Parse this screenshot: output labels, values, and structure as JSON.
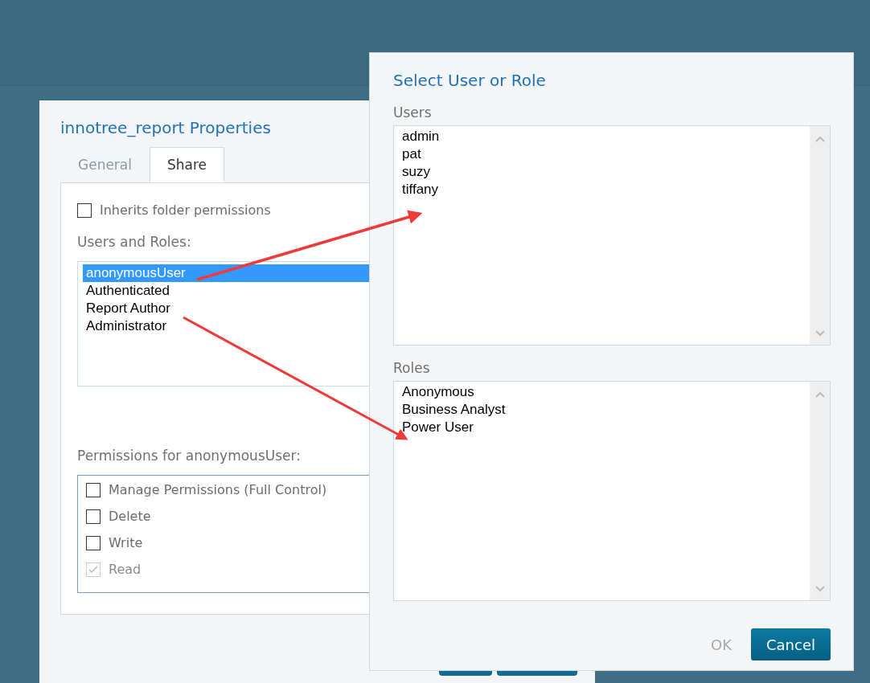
{
  "properties_dialog": {
    "title": "innotree_report Properties",
    "tabs": [
      {
        "label": "General",
        "selected": false
      },
      {
        "label": "Share",
        "selected": true
      }
    ],
    "inherit_checkbox": {
      "label": "Inherits folder permissions",
      "checked": false
    },
    "users_and_roles_label": "Users and Roles:",
    "users_and_roles": [
      {
        "name": "anonymousUser",
        "selected": true
      },
      {
        "name": "Authenticated",
        "selected": false
      },
      {
        "name": "Report Author",
        "selected": false
      },
      {
        "name": "Administrator",
        "selected": false
      }
    ],
    "permissions_label": "Permissions for anonymousUser:",
    "permissions": [
      {
        "label": "Manage Permissions (Full Control)",
        "checked": false,
        "disabled": false
      },
      {
        "label": "Delete",
        "checked": false,
        "disabled": false
      },
      {
        "label": "Write",
        "checked": false,
        "disabled": false
      },
      {
        "label": "Read",
        "checked": true,
        "disabled": true
      }
    ]
  },
  "select_dialog": {
    "title": "Select User or Role",
    "users_label": "Users",
    "users": [
      "admin",
      "pat",
      "suzy",
      "tiffany"
    ],
    "roles_label": "Roles",
    "roles": [
      "Anonymous",
      "Business Analyst",
      "Power User"
    ],
    "buttons": [
      {
        "label": "OK",
        "disabled": true
      },
      {
        "label": "Cancel",
        "disabled": false
      }
    ]
  }
}
